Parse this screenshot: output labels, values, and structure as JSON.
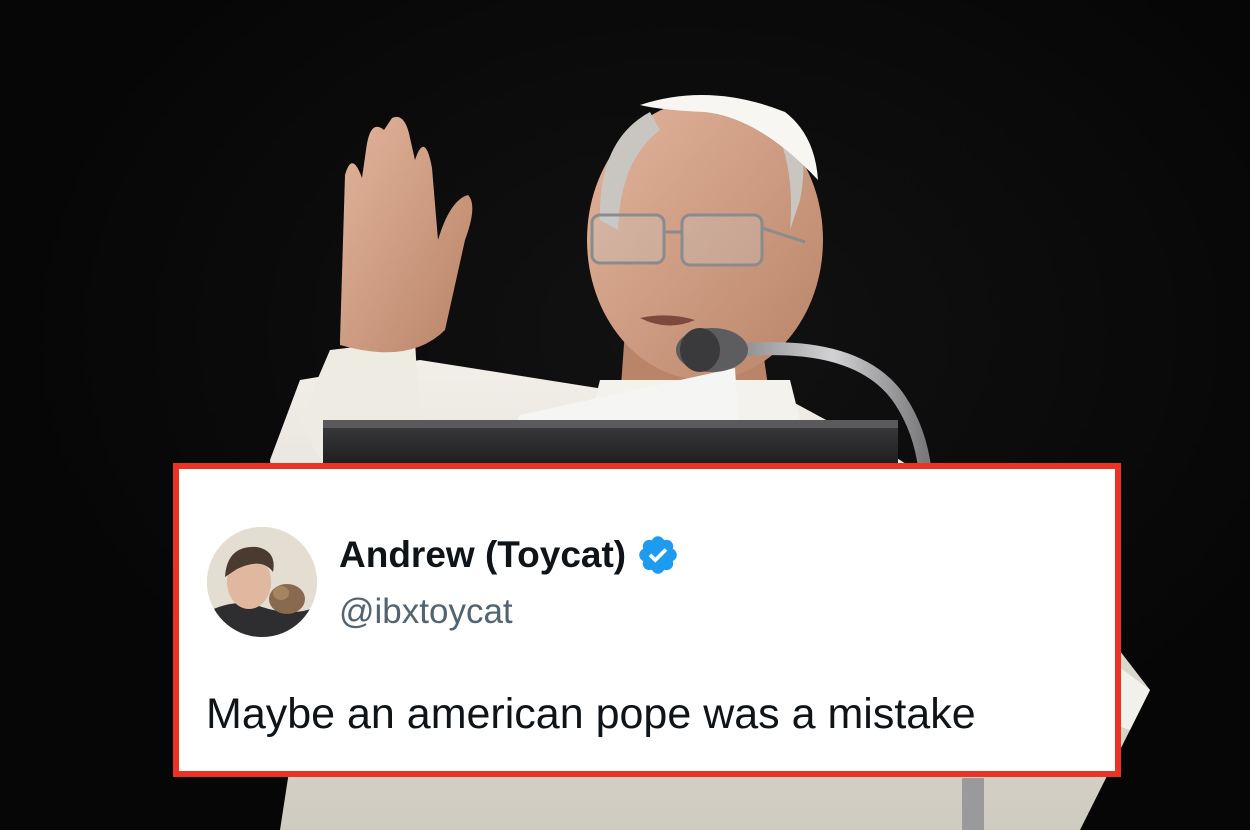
{
  "tweet": {
    "display_name": "Andrew (Toycat)",
    "handle": "@ibxtoycat",
    "text": "Maybe an american pope was a mistake",
    "verified_icon": "verified-badge-icon"
  },
  "colors": {
    "card_border": "#ea3323",
    "card_background": "#ffffff",
    "verified_blue": "#1d9bf0",
    "name_text": "#0f1419",
    "handle_text": "#536471",
    "photo_background": "#070707"
  }
}
